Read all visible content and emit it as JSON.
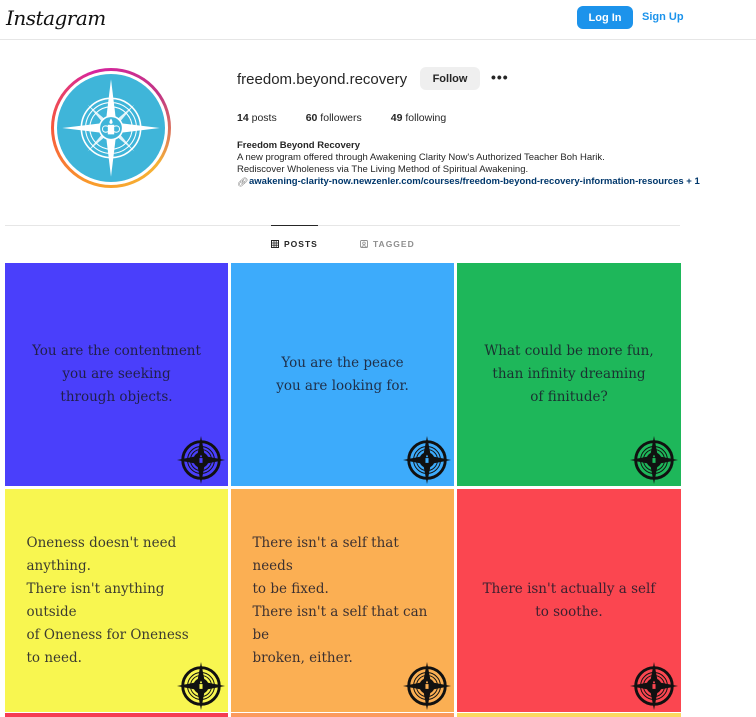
{
  "nav": {
    "logo": "Instagram",
    "login_label": "Log In",
    "signup_label": "Sign Up",
    "colors": {
      "primary_blue": "#1c93eb"
    }
  },
  "profile": {
    "username": "freedom.beyond.recovery",
    "follow_label": "Follow",
    "more_label": "•••",
    "stats": {
      "posts_count": "14",
      "posts_label": " posts",
      "followers_count": "60",
      "followers_label": " followers",
      "following_count": "49",
      "following_label": " following"
    },
    "bio": {
      "name": "Freedom Beyond Recovery",
      "line1": "A new program offered through Awakening Clarity Now's Authorized Teacher Boh Harik.",
      "line2": "Rediscover Wholeness via The Living Method of Spiritual Awakening.",
      "link": "awakening-clarity-now.newzenler.com/courses/freedom-beyond-recovery-information-resources + 1"
    },
    "avatar_icon": "compass-candle-logo-icon"
  },
  "tabs": [
    {
      "label": "POSTS",
      "icon": "grid-icon",
      "active": true
    },
    {
      "label": "TAGGED",
      "icon": "tagged-icon",
      "active": false
    }
  ],
  "posts": [
    {
      "text": "You are the contentment\nyou are seeking\nthrough objects.",
      "bg": "#4a3ffb",
      "align": "center"
    },
    {
      "text": "You are the peace\nyou are looking for.",
      "bg": "#3dabfb",
      "align": "center"
    },
    {
      "text": "What could be more fun,\nthan infinity dreaming\nof finitude?",
      "bg": "#1eb75a",
      "align": "center"
    },
    {
      "text": "Oneness doesn't need\nanything.\nThere isn't anything outside\nof Oneness for Oneness\nto need.",
      "bg": "#f8f650",
      "align": "left"
    },
    {
      "text": "There isn't a self that needs\nto be fixed.\nThere isn't a self that can be\nbroken, either.",
      "bg": "#fbaf53",
      "align": "left"
    },
    {
      "text": "There isn't actually a self\nto soothe.",
      "bg": "#fb4650",
      "align": "center"
    }
  ],
  "next_row_peek_colors": [
    "#f53b52",
    "#fb9a5e",
    "#fbd860"
  ]
}
